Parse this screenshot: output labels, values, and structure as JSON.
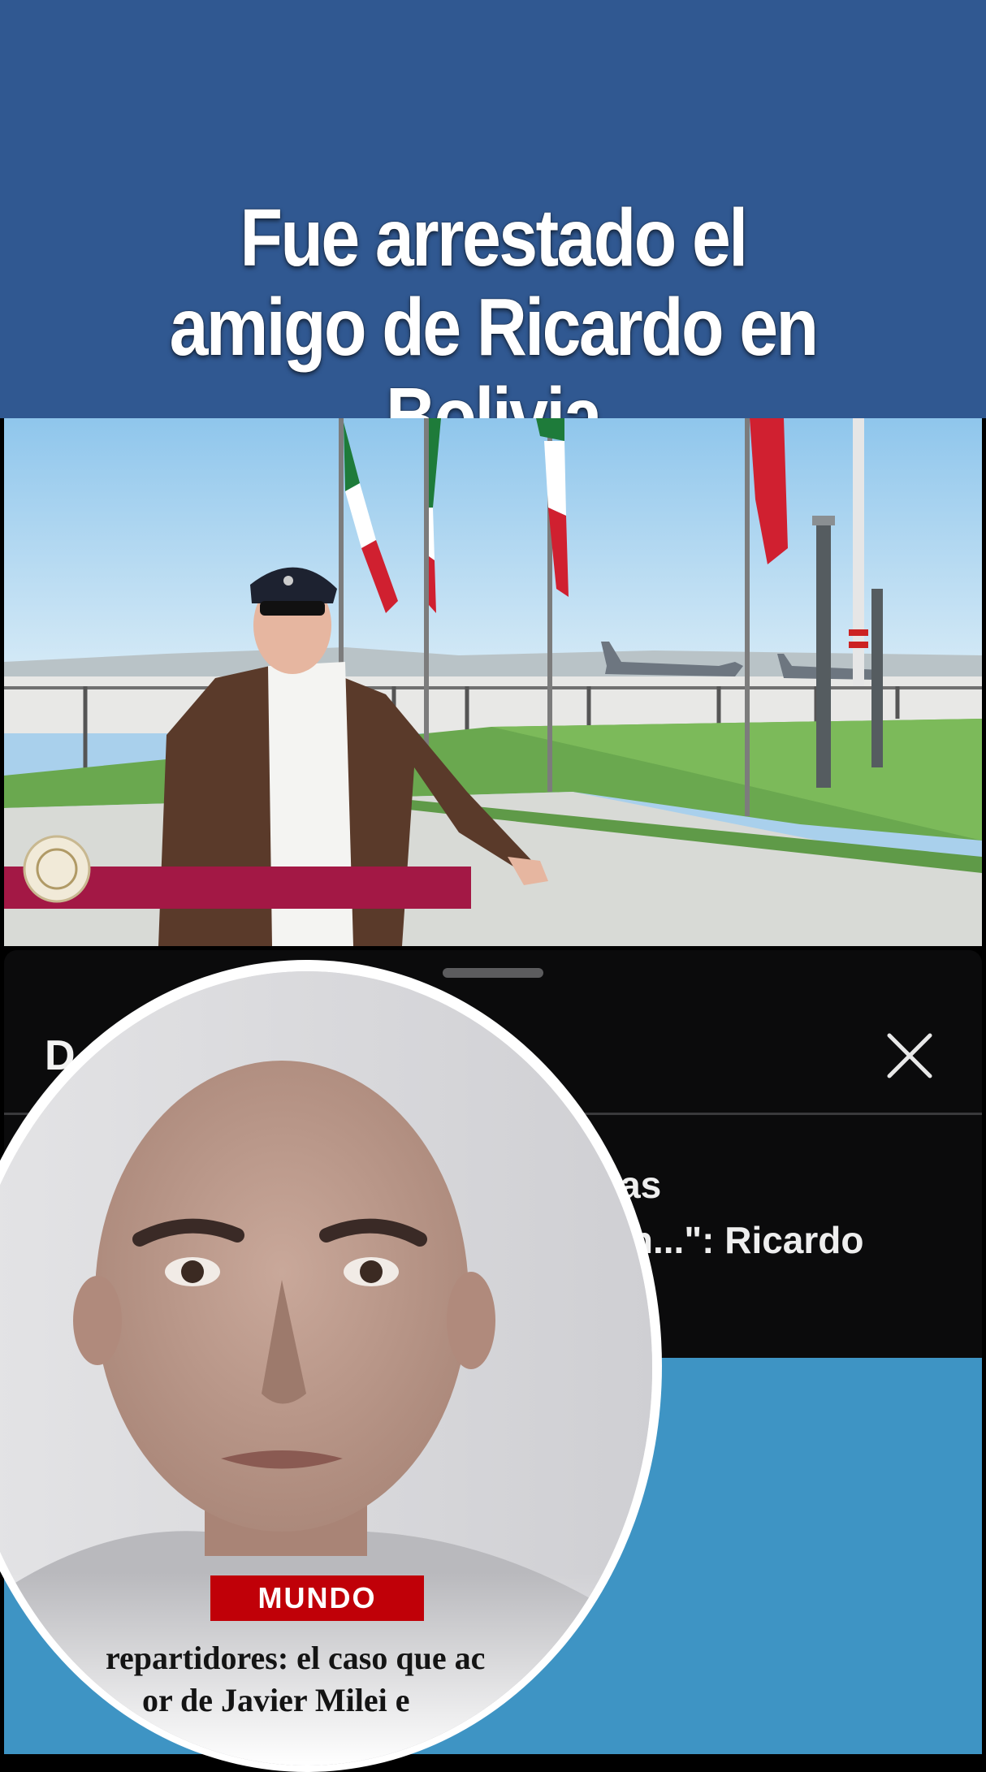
{
  "banner": {
    "title_line1": "Fue arrestado el",
    "title_line2": "amigo de Ricardo en Bolivia",
    "background_color": "#305891"
  },
  "video": {
    "description_icons": [
      "mexico-flag-icon",
      "seal-icon",
      "military-plane-icon"
    ]
  },
  "sheet": {
    "title": "D",
    "item_text_line1": "nas",
    "item_text_line2": "ión...\": Ricardo",
    "close_icon": "close-icon"
  },
  "overlay": {
    "badge": "MUNDO",
    "headline_line1": "repartidores: el caso que ac",
    "headline_line2": "or de Javier Milei e",
    "badge_color": "#c00008"
  }
}
